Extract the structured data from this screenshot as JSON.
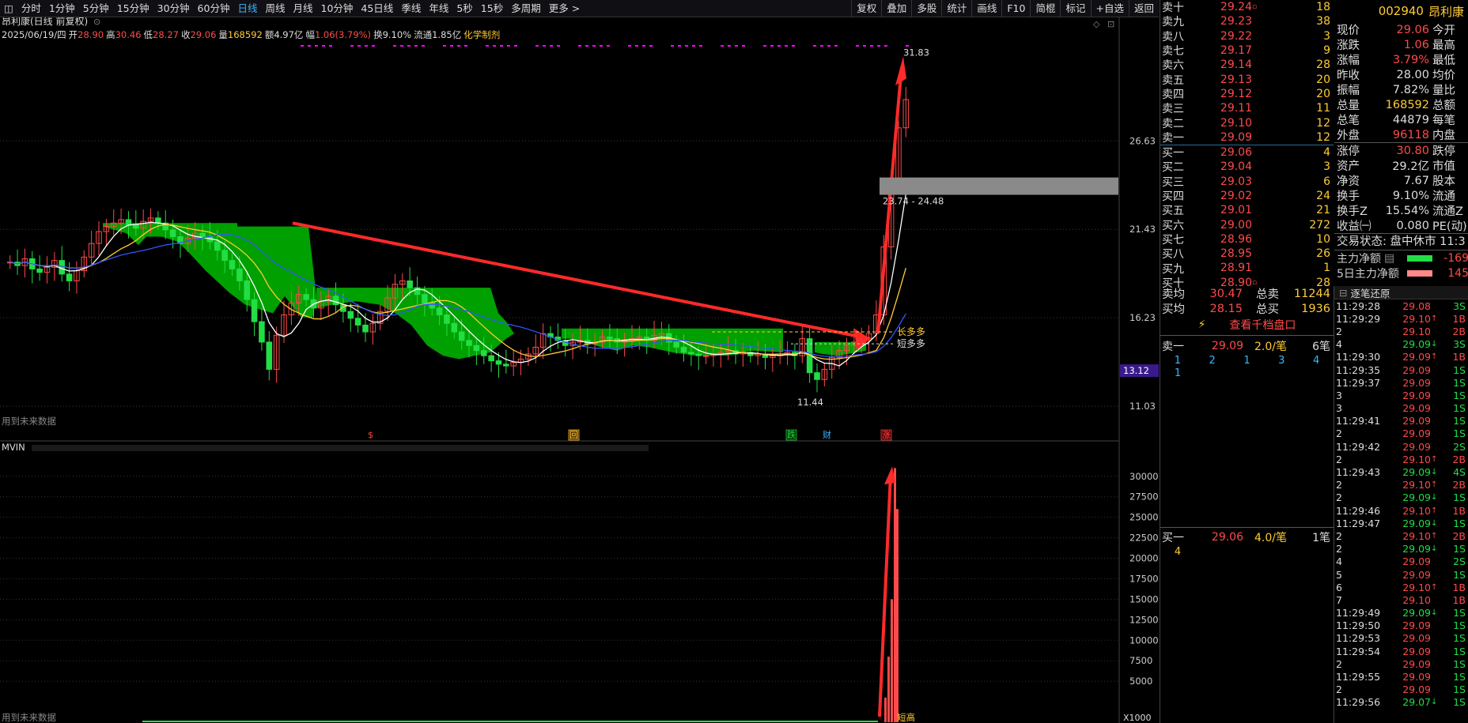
{
  "toolbar": {
    "left": [
      "分时",
      "1分钟",
      "5分钟",
      "15分钟",
      "30分钟",
      "60分钟",
      "日线",
      "周线",
      "月线",
      "10分钟",
      "45日线",
      "季线",
      "年线",
      "5秒",
      "15秒",
      "多周期",
      "更多 >"
    ],
    "active": "日线",
    "right": [
      "复权",
      "叠加",
      "多股",
      "统计",
      "画线",
      "F10",
      "简棍",
      "标记",
      "+自选",
      "返回"
    ]
  },
  "chart": {
    "title": "昂利康(日线 前复权)",
    "info": {
      "date": "2025/06/19/四",
      "open_label": "开",
      "open": "28.90",
      "high_label": "高",
      "high": "30.46",
      "low_label": "低",
      "low": "28.27",
      "close_label": "收",
      "close": "29.06",
      "vol_label": "量",
      "vol": "168592",
      "amt_label": "额",
      "amt": "4.97亿",
      "chg_label": "幅",
      "chg": "1.06(3.79%)",
      "turn_label": "换",
      "turn": "9.10%",
      "float_label": "流通",
      "float": "1.85亿",
      "sector": "化学制剂"
    },
    "y_ticks": [
      "26.63",
      "21.43",
      "16.23",
      "11.03"
    ],
    "highlight_price": "13.12",
    "high_mark": "31.83",
    "low_mark": "11.44",
    "range_label": "23.74 - 24.48",
    "long_label": "长多多",
    "short_label": "短多多",
    "future_data_label": "用到未来数据",
    "events": [
      "$",
      "回",
      "跌",
      "财",
      "涨"
    ],
    "vol_indicator": "MVIN",
    "vol_y_ticks": [
      "30000",
      "27500",
      "25000",
      "22500",
      "20000",
      "17500",
      "15000",
      "12500",
      "10000",
      "7500",
      "5000"
    ],
    "vol_unit": "X1000",
    "vol_label_bottom": "用到未来数据",
    "vol_hint": "短高"
  },
  "chart_data": {
    "type": "candlestick",
    "y_range": [
      9.5,
      32.5
    ],
    "closes": [
      19.5,
      19.3,
      19.7,
      19.1,
      18.9,
      19.2,
      19.6,
      18.8,
      18.4,
      19.0,
      19.8,
      20.6,
      21.3,
      21.6,
      21.8,
      22.0,
      21.7,
      21.5,
      21.9,
      22.1,
      21.8,
      21.4,
      21.0,
      20.6,
      20.9,
      21.2,
      21.0,
      20.7,
      20.2,
      19.6,
      19.1,
      18.4,
      17.3,
      16.0,
      14.8,
      13.2,
      15.2,
      16.4,
      17.1,
      17.6,
      17.3,
      16.8,
      17.2,
      17.5,
      17.0,
      16.6,
      16.2,
      15.8,
      15.4,
      15.9,
      16.6,
      17.4,
      18.2,
      18.4,
      18.0,
      17.6,
      17.1,
      16.8,
      16.4,
      15.9,
      15.4,
      14.9,
      14.6,
      14.3,
      14.0,
      13.7,
      13.5,
      13.4,
      13.6,
      13.8,
      14.1,
      14.5,
      15.3,
      15.1,
      14.9,
      14.6,
      14.8,
      14.9,
      14.7,
      14.8,
      15.1,
      15.0,
      14.8,
      14.9,
      15.0,
      15.1,
      14.9,
      15.2,
      15.3,
      14.8,
      14.5,
      14.2,
      14.1,
      14.0,
      14.0,
      14.1,
      14.2,
      14.3,
      14.1,
      14.2,
      14.0,
      14.1,
      13.9,
      14.0,
      14.1,
      14.2,
      14.0,
      15.0,
      13.0,
      12.6,
      13.2,
      13.9,
      14.3,
      14.6,
      14.8,
      15.0,
      15.3,
      16.4,
      20.4,
      24.3,
      27.4,
      29.06
    ],
    "high": "31.83",
    "low": "11.44",
    "volume_peak_x1000": 31000
  },
  "orderbook": {
    "asks": [
      {
        "label": "卖十",
        "price": "29.24",
        "vol": "18",
        "mark": "▫"
      },
      {
        "label": "卖九",
        "price": "29.23",
        "vol": "38"
      },
      {
        "label": "卖八",
        "price": "29.22",
        "vol": "3"
      },
      {
        "label": "卖七",
        "price": "29.17",
        "vol": "9"
      },
      {
        "label": "卖六",
        "price": "29.14",
        "vol": "28"
      },
      {
        "label": "卖五",
        "price": "29.13",
        "vol": "20"
      },
      {
        "label": "卖四",
        "price": "29.12",
        "vol": "20"
      },
      {
        "label": "卖三",
        "price": "29.11",
        "vol": "11"
      },
      {
        "label": "卖二",
        "price": "29.10",
        "vol": "12"
      },
      {
        "label": "卖一",
        "price": "29.09",
        "vol": "12"
      }
    ],
    "bids": [
      {
        "label": "买一",
        "price": "29.06",
        "vol": "4"
      },
      {
        "label": "买二",
        "price": "29.04",
        "vol": "3"
      },
      {
        "label": "买三",
        "price": "29.03",
        "vol": "6"
      },
      {
        "label": "买四",
        "price": "29.02",
        "vol": "24"
      },
      {
        "label": "买五",
        "price": "29.01",
        "vol": "21"
      },
      {
        "label": "买六",
        "price": "29.00",
        "vol": "272"
      },
      {
        "label": "买七",
        "price": "28.96",
        "vol": "10"
      },
      {
        "label": "买八",
        "price": "28.95",
        "vol": "26"
      },
      {
        "label": "买九",
        "price": "28.91",
        "vol": "1"
      },
      {
        "label": "买十",
        "price": "28.90",
        "vol": "28",
        "mark": "▫"
      }
    ]
  },
  "quote": {
    "code": "002940",
    "name": "昂利康",
    "rows": [
      {
        "k": "现价",
        "v": "29.06",
        "c": "",
        "k2": "今开"
      },
      {
        "k": "涨跌",
        "v": "1.06",
        "c": "",
        "k2": "最高"
      },
      {
        "k": "涨幅",
        "v": "3.79%",
        "c": "",
        "k2": "最低"
      },
      {
        "k": "昨收",
        "v": "28.00",
        "c": "w",
        "k2": "均价"
      },
      {
        "k": "振幅",
        "v": "7.82%",
        "c": "w",
        "k2": "量比"
      },
      {
        "k": "总量",
        "v": "168592",
        "c": "y",
        "k2": "总额"
      },
      {
        "k": "总笔",
        "v": "44879",
        "c": "w",
        "k2": "每笔"
      },
      {
        "k": "外盘",
        "v": "96118",
        "c": "",
        "k2": "内盘"
      }
    ],
    "rows2": [
      {
        "k": "涨停",
        "v": "30.80",
        "c": "",
        "k2": "跌停"
      },
      {
        "k": "资产",
        "v": "29.2亿",
        "c": "w",
        "k2": "市值"
      },
      {
        "k": "净资",
        "v": "7.67",
        "c": "w",
        "k2": "股本"
      },
      {
        "k": "换手",
        "v": "9.10%",
        "c": "w",
        "k2": "流通"
      },
      {
        "k": "换手Z",
        "v": "15.54%",
        "c": "w",
        "k2": "流通Z"
      },
      {
        "k": "收益㈠",
        "v": "0.080",
        "c": "w",
        "k2": "PE(动)"
      }
    ],
    "status": "交易状态: 盘中休市 11:3",
    "flow1_label": "主力净额",
    "flow1_val": "-169",
    "flow2_label": "5日主力净额",
    "flow2_val": "145"
  },
  "summary": {
    "ask_avg_label": "卖均",
    "ask_avg": "30.47",
    "ask_total_label": "总卖",
    "ask_total": "11244",
    "bid_avg_label": "买均",
    "bid_avg": "28.15",
    "bid_total_label": "总买",
    "bid_total": "1936",
    "view_1000": "查看千档盘口"
  },
  "queue": {
    "ask": {
      "label": "卖一",
      "price": "29.09",
      "per": "2.0/笔",
      "count": "6笔",
      "nums": [
        "1",
        "2",
        "1",
        "3",
        "4"
      ],
      "nums2": [
        "1"
      ]
    },
    "bid": {
      "label": "买一",
      "price": "29.06",
      "per": "4.0/笔",
      "count": "1笔",
      "nums": [
        "4"
      ]
    }
  },
  "ticks": {
    "title": "逐笔还原",
    "rows": [
      {
        "t": "11:29:28",
        "p": "29.08",
        "d": "",
        "n": "3S"
      },
      {
        "t": "11:29:29",
        "p": "29.10",
        "d": "up",
        "n": "1B"
      },
      {
        "t": "2",
        "p": "29.10",
        "d": "",
        "n": "2B"
      },
      {
        "t": "4",
        "p": "29.09",
        "d": "dn",
        "n": "3S"
      },
      {
        "t": "11:29:30",
        "p": "29.09",
        "d": "up",
        "n": "1B"
      },
      {
        "t": "11:29:35",
        "p": "29.09",
        "d": "",
        "n": "1S"
      },
      {
        "t": "11:29:37",
        "p": "29.09",
        "d": "",
        "n": "1S"
      },
      {
        "t": "3",
        "p": "29.09",
        "d": "",
        "n": "1S"
      },
      {
        "t": "3",
        "p": "29.09",
        "d": "",
        "n": "1S"
      },
      {
        "t": "11:29:41",
        "p": "29.09",
        "d": "",
        "n": "1S"
      },
      {
        "t": "2",
        "p": "29.09",
        "d": "",
        "n": "1S"
      },
      {
        "t": "11:29:42",
        "p": "29.09",
        "d": "",
        "n": "2S"
      },
      {
        "t": "2",
        "p": "29.10",
        "d": "up",
        "n": "2B"
      },
      {
        "t": "11:29:43",
        "p": "29.09",
        "d": "dn",
        "n": "4S"
      },
      {
        "t": "2",
        "p": "29.10",
        "d": "up",
        "n": "2B"
      },
      {
        "t": "2",
        "p": "29.09",
        "d": "dn",
        "n": "1S"
      },
      {
        "t": "11:29:46",
        "p": "29.10",
        "d": "up",
        "n": "1B"
      },
      {
        "t": "11:29:47",
        "p": "29.09",
        "d": "dn",
        "n": "1S"
      },
      {
        "t": "2",
        "p": "29.10",
        "d": "up",
        "n": "2B"
      },
      {
        "t": "2",
        "p": "29.09",
        "d": "dn",
        "n": "1S"
      },
      {
        "t": "4",
        "p": "29.09",
        "d": "",
        "n": "2S"
      },
      {
        "t": "5",
        "p": "29.09",
        "d": "",
        "n": "1S"
      },
      {
        "t": "6",
        "p": "29.10",
        "d": "up",
        "n": "1B"
      },
      {
        "t": "7",
        "p": "29.10",
        "d": "",
        "n": "1B"
      },
      {
        "t": "11:29:49",
        "p": "29.09",
        "d": "dn",
        "n": "1S"
      },
      {
        "t": "11:29:50",
        "p": "29.09",
        "d": "",
        "n": "1S"
      },
      {
        "t": "11:29:53",
        "p": "29.09",
        "d": "",
        "n": "1S"
      },
      {
        "t": "11:29:54",
        "p": "29.09",
        "d": "",
        "n": "1S"
      },
      {
        "t": "2",
        "p": "29.09",
        "d": "",
        "n": "1S"
      },
      {
        "t": "11:29:55",
        "p": "29.09",
        "d": "",
        "n": "1S"
      },
      {
        "t": "2",
        "p": "29.09",
        "d": "",
        "n": "1S"
      },
      {
        "t": "11:29:56",
        "p": "29.07",
        "d": "dn",
        "n": "1S"
      }
    ]
  },
  "colors": {
    "up": "#ff4a4a",
    "down": "#22dd44",
    "accent": "#39b7ff",
    "yellow": "#ffcc33",
    "cloud": "#00a000"
  }
}
